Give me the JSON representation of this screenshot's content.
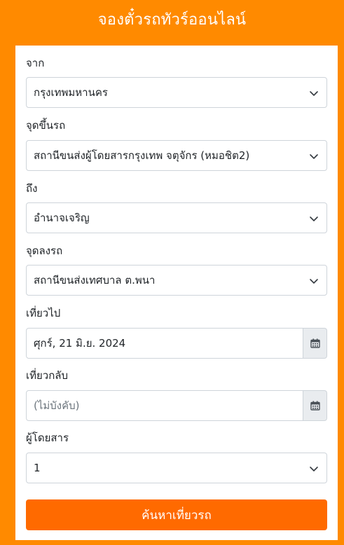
{
  "header": {
    "title": "จองตั๋วรถทัวร์ออนไลน์"
  },
  "form": {
    "from": {
      "label": "จาก",
      "value": "กรุงเทพมหานคร"
    },
    "pickup": {
      "label": "จุดขึ้นรถ",
      "value": "สถานีขนส่งผู้โดยสารกรุงเทพ จตุจักร (หมอชิต2)"
    },
    "to": {
      "label": "ถึง",
      "value": "อำนาจเจริญ"
    },
    "dropoff": {
      "label": "จุดลงรถ",
      "value": "สถานีขนส่งเทศบาล ต.พนา"
    },
    "depart": {
      "label": "เที่ยวไป",
      "value": "ศุกร์, 21 มิ.ย. 2024"
    },
    "return": {
      "label": "เที่ยวกลับ",
      "placeholder": "(ไม่บังคับ)"
    },
    "passengers": {
      "label": "ผู้โดยสาร",
      "value": "1"
    },
    "search_button": "ค้นหาเที่ยวรถ"
  },
  "icons": {
    "select": "chevron-down-icon",
    "date": "calendar-icon"
  },
  "colors": {
    "background": "#FF8A00",
    "button": "#FF6A00"
  }
}
